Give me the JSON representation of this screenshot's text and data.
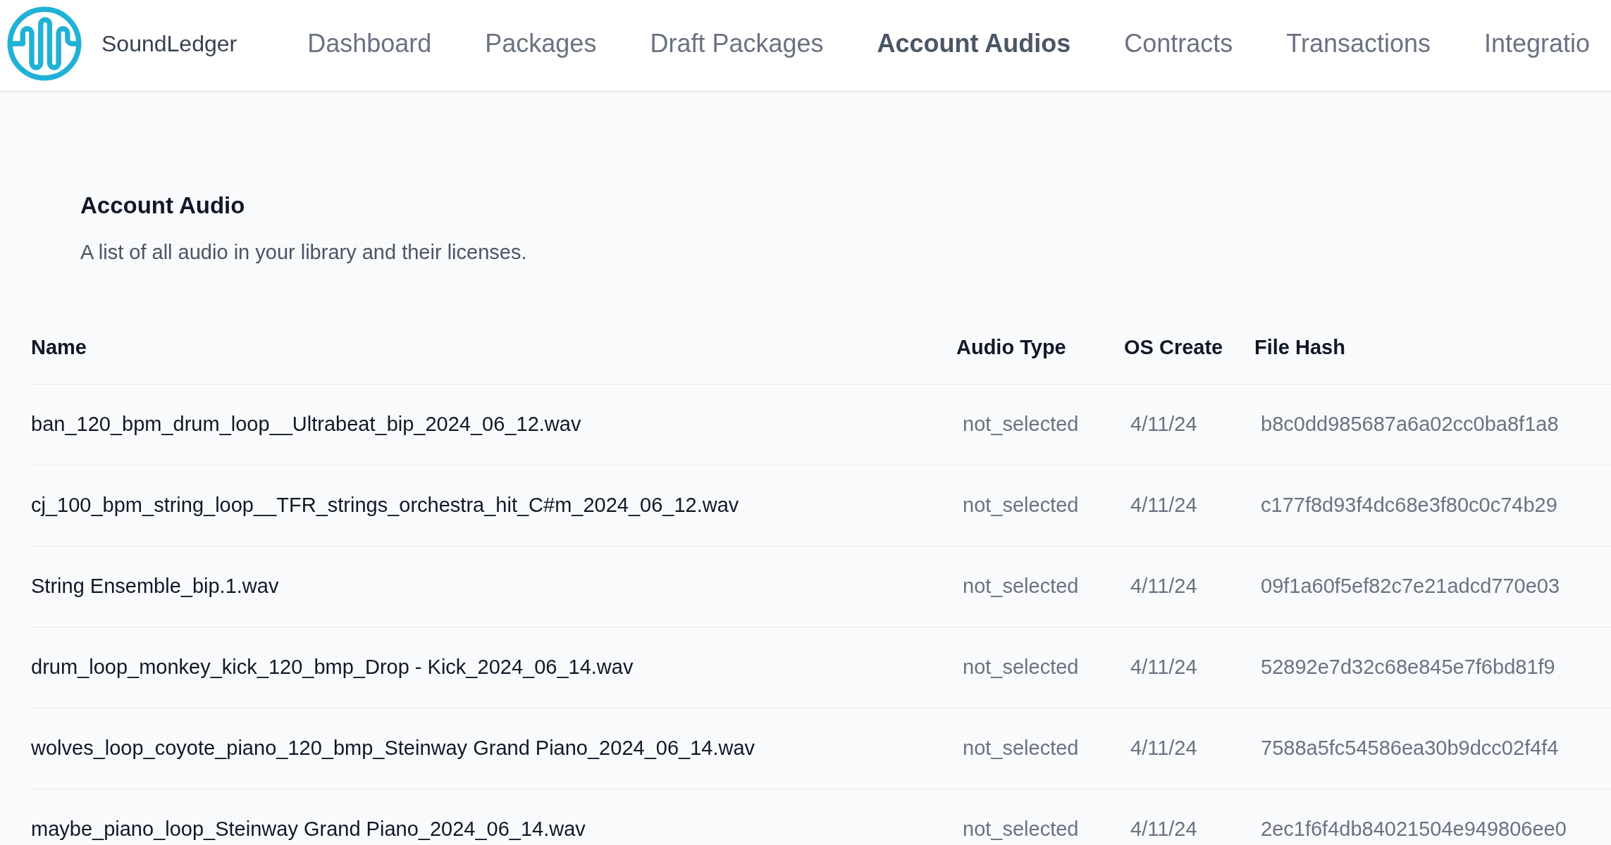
{
  "header": {
    "brand": "SoundLedger",
    "nav": [
      {
        "label": "Dashboard",
        "selected": false
      },
      {
        "label": "Packages",
        "selected": false
      },
      {
        "label": "Draft Packages",
        "selected": false
      },
      {
        "label": "Account Audios",
        "selected": true
      },
      {
        "label": "Contracts",
        "selected": false
      },
      {
        "label": "Transactions",
        "selected": false
      },
      {
        "label": "Integratio",
        "selected": false
      }
    ]
  },
  "page": {
    "title": "Account Audio",
    "description": "A list of all audio in your library and their licenses."
  },
  "table": {
    "columns": [
      "Name",
      "Audio Type",
      "OS Create",
      "File Hash"
    ],
    "rows": [
      {
        "name": "ban_120_bpm_drum_loop__Ultrabeat_bip_2024_06_12.wav",
        "audio_type": "not_selected",
        "os_create": "4/11/24",
        "file_hash": "b8c0dd985687a6a02cc0ba8f1a8"
      },
      {
        "name": "cj_100_bpm_string_loop__TFR_strings_orchestra_hit_C#m_2024_06_12.wav",
        "audio_type": "not_selected",
        "os_create": "4/11/24",
        "file_hash": "c177f8d93f4dc68e3f80c0c74b29"
      },
      {
        "name": "String Ensemble_bip.1.wav",
        "audio_type": "not_selected",
        "os_create": "4/11/24",
        "file_hash": "09f1a60f5ef82c7e21adcd770e03"
      },
      {
        "name": "drum_loop_monkey_kick_120_bmp_Drop - Kick_2024_06_14.wav",
        "audio_type": "not_selected",
        "os_create": "4/11/24",
        "file_hash": "52892e7d32c68e845e7f6bd81f9"
      },
      {
        "name": "wolves_loop_coyote_piano_120_bmp_Steinway Grand Piano_2024_06_14.wav",
        "audio_type": "not_selected",
        "os_create": "4/11/24",
        "file_hash": "7588a5fc54586ea30b9dcc02f4f4"
      },
      {
        "name": "maybe_piano_loop_Steinway Grand Piano_2024_06_14.wav",
        "audio_type": "not_selected",
        "os_create": "4/11/24",
        "file_hash": "2ec1f6f4db84021504e949806ee0"
      }
    ]
  }
}
